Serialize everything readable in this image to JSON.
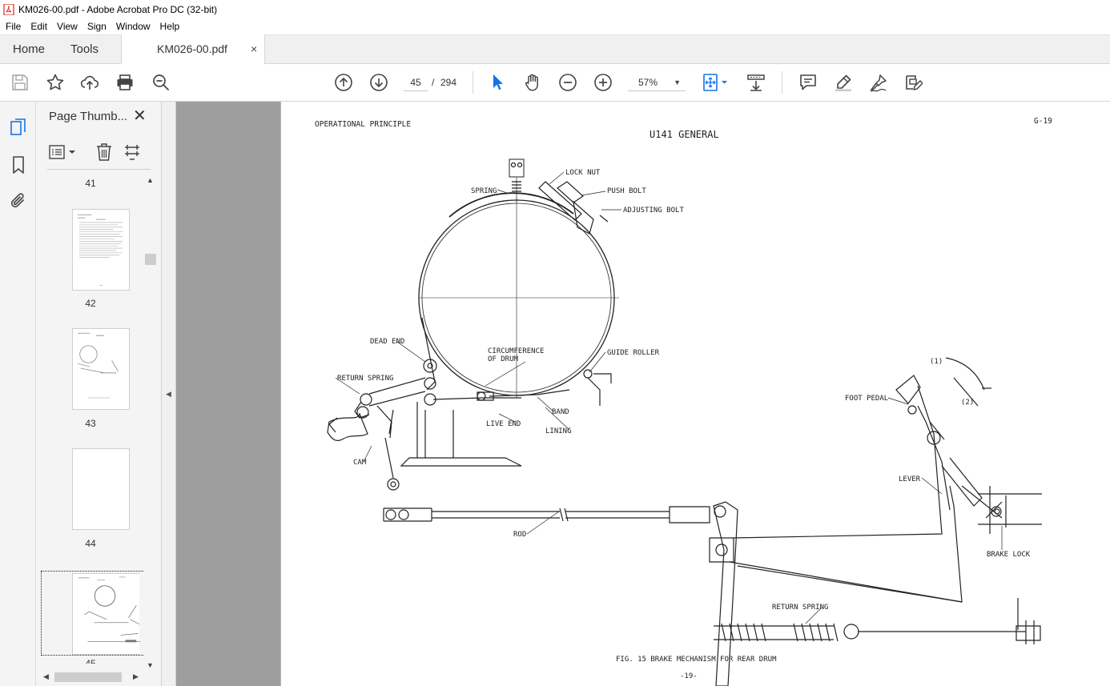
{
  "window": {
    "title": "KM026-00.pdf - Adobe Acrobat Pro DC (32-bit)"
  },
  "menu": [
    "File",
    "Edit",
    "View",
    "Sign",
    "Window",
    "Help"
  ],
  "tabs": {
    "home": "Home",
    "tools": "Tools",
    "document": "KM026-00.pdf",
    "close": "×"
  },
  "toolbar": {
    "current_page": "45",
    "page_separator": "/",
    "total_pages": "294",
    "zoom": "57%",
    "icons": [
      "save-icon",
      "star-icon",
      "upload-icon",
      "print-icon",
      "search-zoom-icon",
      "page-up-icon",
      "page-down-icon",
      "select-cursor-icon",
      "hand-icon",
      "zoom-out-icon",
      "zoom-in-icon",
      "fit-page-icon",
      "scroll-mode-icon",
      "comment-icon",
      "highlight-icon",
      "sign-icon",
      "edit-pdf-icon"
    ]
  },
  "thumbnails_panel": {
    "title": "Page Thumb...",
    "close": "✕",
    "pages": [
      {
        "number": "41"
      },
      {
        "number": "42"
      },
      {
        "number": "43"
      },
      {
        "number": "44"
      },
      {
        "number": "45",
        "selected": true
      }
    ]
  },
  "document_page": {
    "header_left": "OPERATIONAL PRINCIPLE",
    "header_center": "U141 GENERAL",
    "header_right": "G-19",
    "labels": {
      "lock_nut": "LOCK NUT",
      "spring": "SPRING",
      "push_bolt": "PUSH BOLT",
      "adjusting_bolt": "ADJUSTING BOLT",
      "dead_end": "DEAD END",
      "circumference_1": "CIRCUMFERENCE",
      "circumference_2": "OF DRUM",
      "guide_roller": "GUIDE ROLLER",
      "return_spring_top": "RETURN SPRING",
      "live_end": "LIVE END",
      "band": "BAND",
      "lining": "LINING",
      "cam": "CAM",
      "rod": "ROD",
      "foot_pedal": "FOOT PEDAL",
      "pos1": "(1)",
      "pos2": "(2)",
      "lever": "LEVER",
      "brake_lock": "BRAKE LOCK",
      "return_spring_bottom": "RETURN SPRING"
    },
    "caption": "FIG. 15  BRAKE MECHANISM FOR REAR DRUM",
    "footer": "-19-"
  }
}
